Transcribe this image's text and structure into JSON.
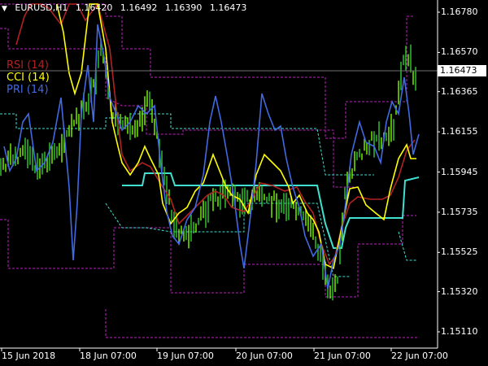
{
  "chart_data": {
    "type": "line",
    "symbol": "EURUSD,H1",
    "ohlc": [
      "1.16420",
      "1.16492",
      "1.16390",
      "1.16473"
    ],
    "last_price": "1.16473",
    "legend": [
      {
        "label": "RSI (14)",
        "color": "#b22222"
      },
      {
        "label": "CCI (14)",
        "color": "#ffff00"
      },
      {
        "label": "PRI (14)",
        "color": "#4169e1"
      }
    ],
    "y_ticks": [
      "1.16780",
      "1.16570",
      "1.16365",
      "1.16155",
      "1.15945",
      "1.15735",
      "1.15525",
      "1.15320",
      "1.15110"
    ],
    "x_ticks": [
      "15 Jun 2018",
      "18 Jun 07:00",
      "19 Jun 07:00",
      "20 Jun 07:00",
      "21 Jun 07:00",
      "22 Jun 07:00"
    ],
    "ylim": [
      1.1505,
      1.1685
    ],
    "grid": false,
    "colors": {
      "background": "#000000",
      "price": "#32cd32",
      "price_high": "#7cfc00",
      "channel": "#40e0d0",
      "bands": "#c020c0",
      "rsi": "#b22222",
      "cci": "#ffff00",
      "pri": "#4169e1",
      "axis": "#ffffff"
    }
  }
}
